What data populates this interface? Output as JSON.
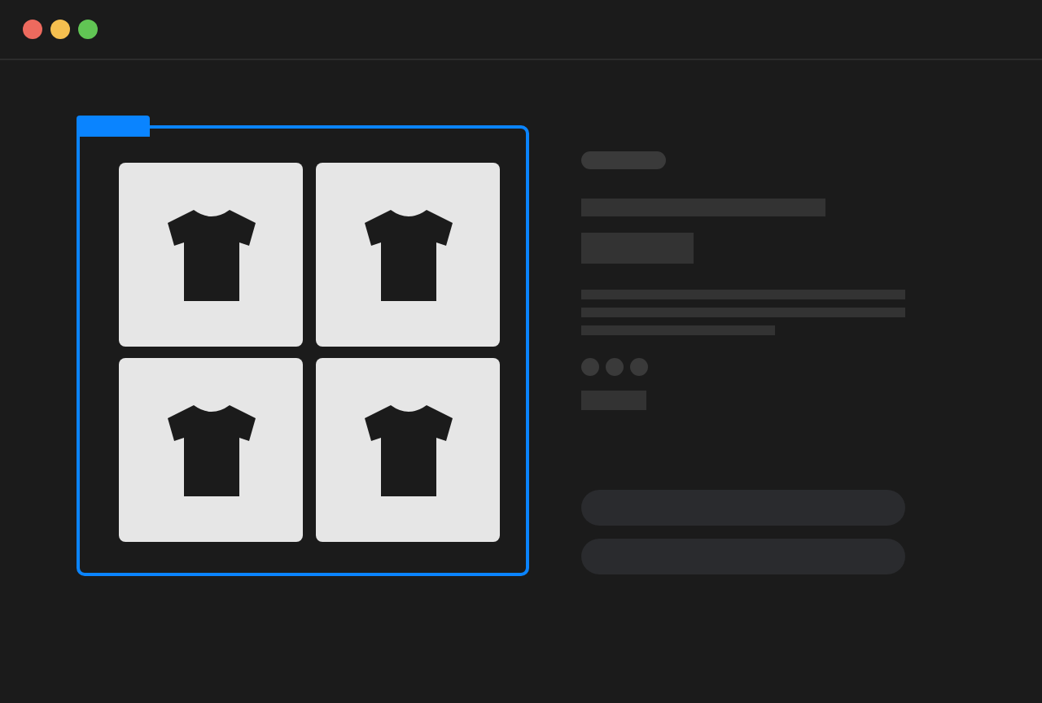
{
  "window": {
    "controls": [
      {
        "color": "#ed6a5e"
      },
      {
        "color": "#f5bf4f"
      },
      {
        "color": "#61c554"
      }
    ]
  },
  "gallery": {
    "selected": true,
    "tiles": [
      {
        "kind": "shirt"
      },
      {
        "kind": "shirt"
      },
      {
        "kind": "shirt"
      },
      {
        "kind": "shirt"
      }
    ]
  },
  "details": {
    "swatches": [
      {
        "kind": "dot"
      },
      {
        "kind": "dot"
      },
      {
        "kind": "dot"
      }
    ],
    "buttons": [
      {
        "kind": "pill"
      },
      {
        "kind": "pill"
      }
    ]
  }
}
